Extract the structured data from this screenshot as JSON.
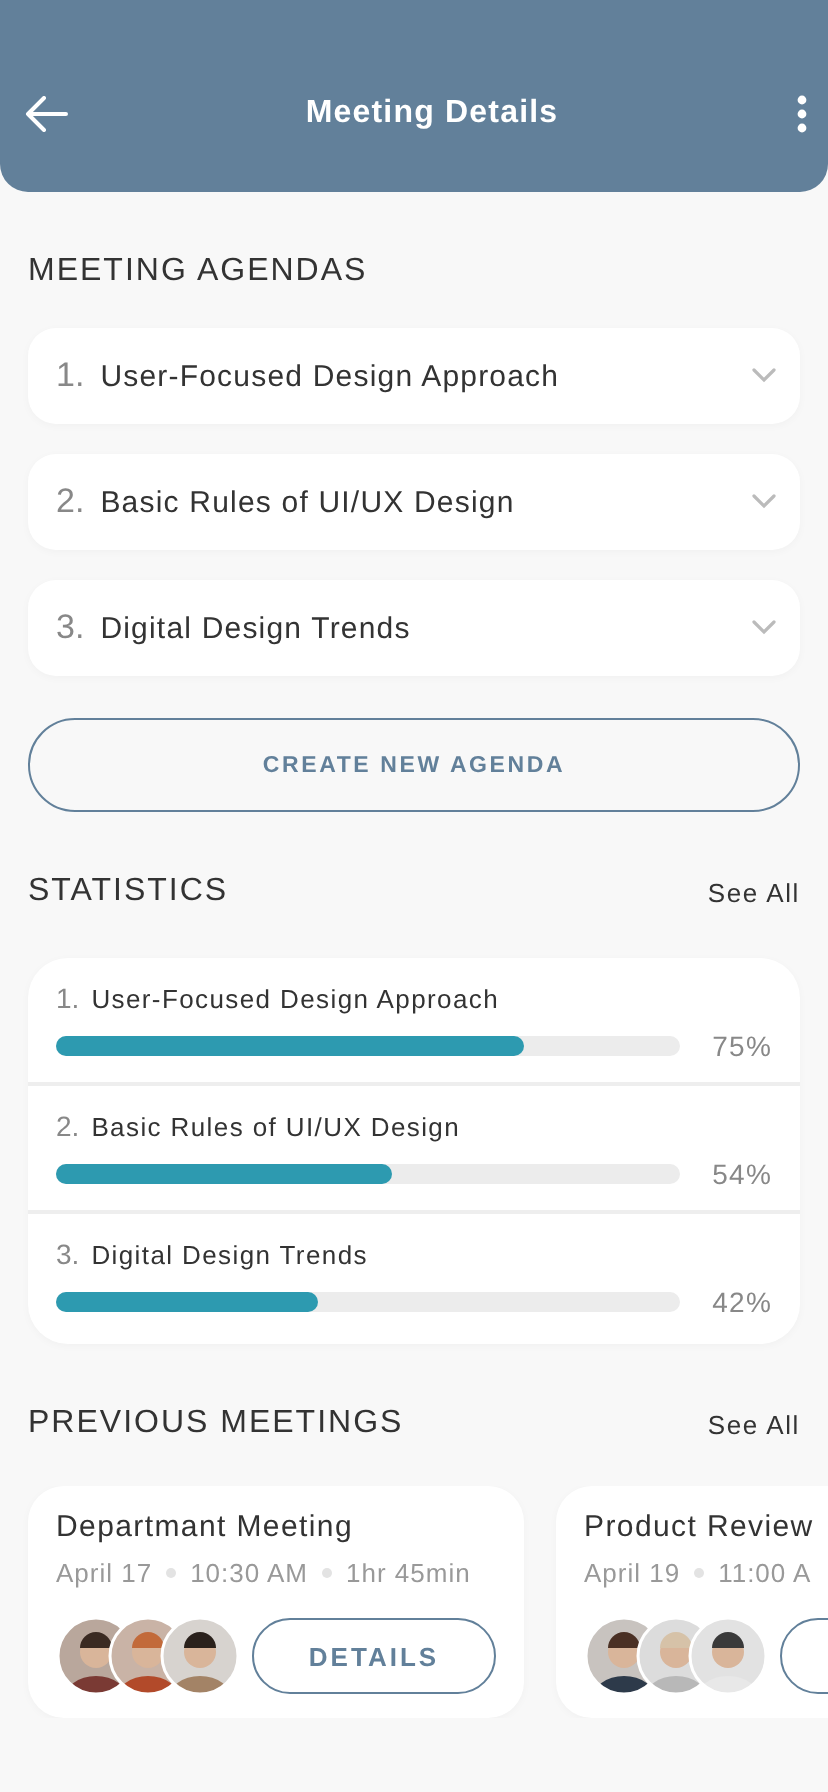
{
  "header": {
    "title": "Meeting Details"
  },
  "agendas": {
    "heading": "MEETING AGENDAS",
    "items": [
      {
        "number": "1.",
        "title": "User-Focused Design Approach",
        "expanded": false
      },
      {
        "number": "2.",
        "title": "Basic Rules of UI/UX Design",
        "expanded": false
      },
      {
        "number": "3.",
        "title": "Digital Design Trends",
        "expanded": false
      }
    ],
    "button": "CREATE NEW AGENDA"
  },
  "statistics": {
    "heading": "STATISTICS",
    "link": "See All",
    "items": [
      {
        "number": "1.",
        "title": "User-Focused Design Approach",
        "level": 0.75,
        "reading": "75%"
      },
      {
        "number": "2.",
        "title": "Basic Rules of UI/UX Design",
        "level": 0.54,
        "reading": "54%"
      },
      {
        "number": "3.",
        "title": "Digital Design Trends",
        "level": 0.42,
        "reading": "42%"
      }
    ]
  },
  "previous_meetings": {
    "heading": "PREVIOUS MEETINGS",
    "link": "See All",
    "items": [
      {
        "title": "Departmant Meeting",
        "date": "April 17",
        "time": "10:30 AM",
        "duration": "1hr 45min",
        "button": "DETAILS"
      },
      {
        "title": "Product Review",
        "date": "April 19",
        "time": "11:00 A"
      }
    ]
  }
}
